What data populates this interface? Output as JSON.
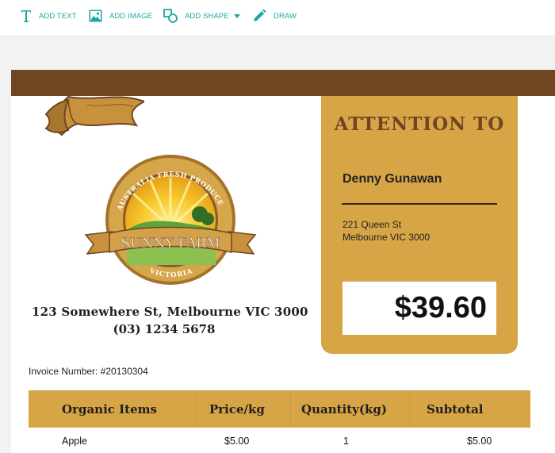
{
  "toolbar": {
    "add_text": "ADD TEXT",
    "add_image": "ADD IMAGE",
    "add_shape": "ADD SHAPE",
    "draw": "DRAW",
    "icons": [
      "text-icon",
      "image-icon",
      "shape-icon",
      "caret-down-icon",
      "pencil-icon"
    ],
    "accent_color": "#1ba8a3"
  },
  "invoice": {
    "logo": {
      "top_arc": "AUSTRALIA FRESH PRODUCE",
      "banner": "SUNNY FARM",
      "bottom_arc": "VICTORIA"
    },
    "company_address": "123 Somewhere St, Melbourne VIC 3000",
    "company_phone": "(03) 1234 5678",
    "invoice_number": "Invoice Number: #20130304",
    "attention": {
      "title": "ATTENTION TO",
      "name": "Denny Gunawan",
      "address_line1": "221 Queen St",
      "address_line2": "Melbourne VIC 3000",
      "total": "$39.60"
    },
    "table": {
      "headers": [
        "Organic Items",
        "Price/kg",
        "Quantity(kg)",
        "Subtotal"
      ],
      "rows": [
        [
          "Apple",
          "$5.00",
          "1",
          "$5.00"
        ]
      ]
    },
    "colors": {
      "brown": "#6f4522",
      "gold": "#d7a546"
    }
  }
}
